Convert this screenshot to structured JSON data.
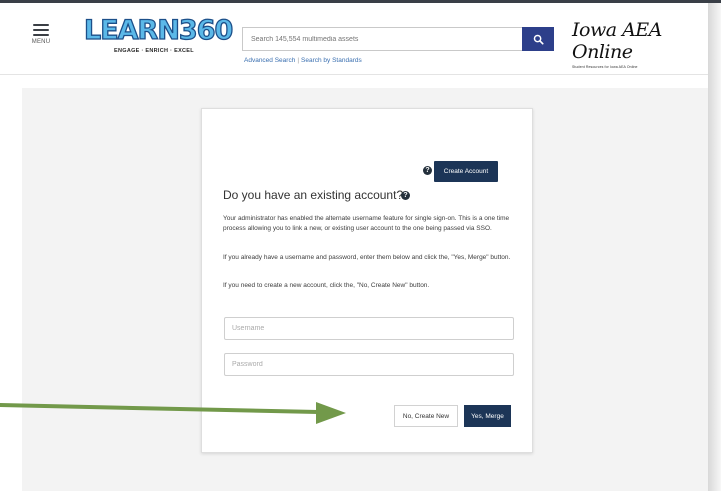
{
  "header": {
    "menu_label": "MENU",
    "logo": {
      "word": "LEARN360",
      "tagline": "ENGAGE · ENRICH · EXCEL"
    },
    "search": {
      "placeholder": "Search 145,554 multimedia assets",
      "button_icon": "search-icon",
      "links": {
        "advanced": "Advanced Search",
        "separator": "|",
        "standards": "Search by Standards"
      }
    },
    "partner": {
      "title": "Iowa AEA Online",
      "subtitle": "Student Resources for Iowa AEA Online"
    }
  },
  "card": {
    "create_account_label": "Create Account",
    "heading": "Do you have an existing account?",
    "paragraphs": [
      "Your administrator has enabled the alternate username feature for single sign-on. This is a one time process allowing you to link a new, or existing user account to the one being passed via SSO.",
      "If you already have a username and password, enter them below and click the, \"Yes, Merge\" button.",
      "If you need to create a new account, click the, \"No, Create New\" button."
    ],
    "username_placeholder": "Username",
    "password_placeholder": "Password",
    "no_create_label": "No, Create New",
    "yes_merge_label": "Yes, Merge"
  },
  "colors": {
    "primary_button": "#1c3557",
    "search_button": "#2d3f8a",
    "annotation_arrow": "#72994a"
  }
}
